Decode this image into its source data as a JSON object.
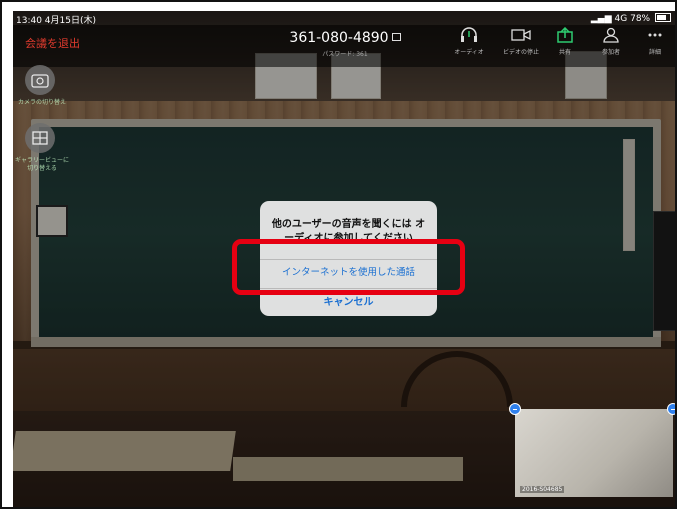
{
  "status": {
    "time_date": "13:40 4月15日(木)",
    "signal": "4G",
    "battery": "78%"
  },
  "header": {
    "leave_label": "会議を退出",
    "meeting_id": "361-080-4890",
    "password_label": "パスワード: 361"
  },
  "toolbar": {
    "audio_label": "オーディオ",
    "video_label": "ビデオの停止",
    "share_label": "共有",
    "participants_label": "参加者",
    "more_label": "詳細",
    "share_color": "#2ecc71"
  },
  "side": {
    "switch_camera_label": "カメラの切り替え",
    "gallery_label": "ギャラリービューに切り替える"
  },
  "dialog": {
    "message": "他のユーザーの音声を聞くには オーディオに参加してください",
    "internet_audio_label": "インターネットを使用した通話",
    "cancel_label": "キャンセル",
    "highlight_color": "#e60012"
  },
  "self_view": {
    "label": "2016-S04685"
  }
}
